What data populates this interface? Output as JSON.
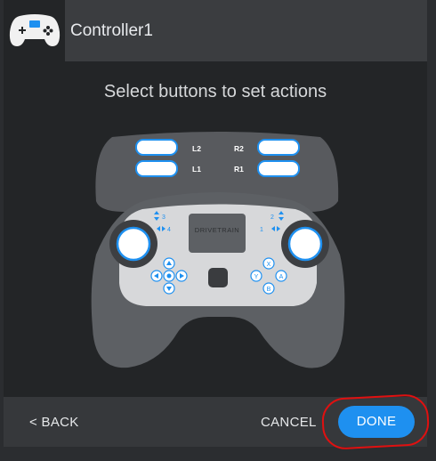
{
  "header": {
    "title": "Controller1",
    "icon": "gamepad-icon"
  },
  "instruction": "Select buttons to set actions",
  "controller": {
    "shoulder_labels": {
      "l2": "L2",
      "r2": "R2",
      "l1": "L1",
      "r1": "R1"
    },
    "screen_label": "DRIVETRAIN",
    "axis_labels": {
      "a3": "3",
      "a4": "4",
      "a2": "2",
      "a1": "1"
    },
    "face_buttons": {
      "x": "X",
      "y": "Y",
      "a": "A",
      "b": "B"
    }
  },
  "footer": {
    "back_label": "< BACK",
    "cancel_label": "CANCEL",
    "done_label": "DONE"
  },
  "colors": {
    "accent": "#1e90f0",
    "annotation": "#e01010"
  }
}
